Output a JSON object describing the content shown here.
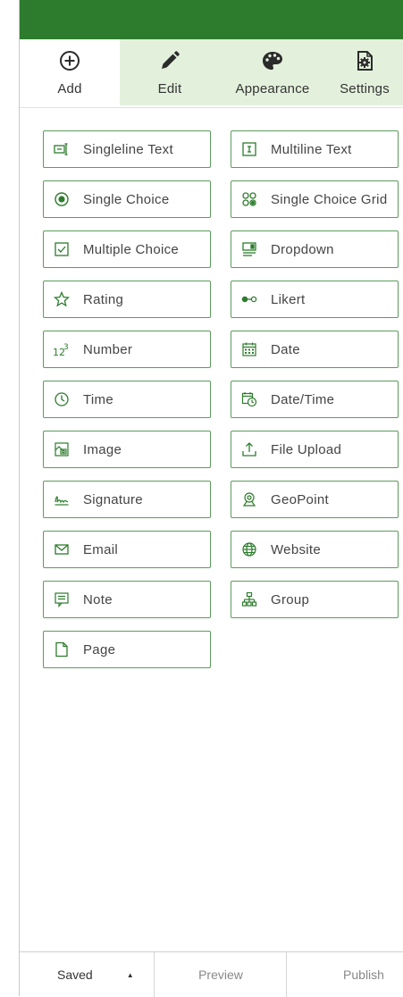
{
  "tabs": [
    {
      "label": "Add",
      "icon": "plus-circle-icon",
      "active": true
    },
    {
      "label": "Edit",
      "icon": "pencil-icon",
      "active": false
    },
    {
      "label": "Appearance",
      "icon": "palette-icon",
      "active": false
    },
    {
      "label": "Settings",
      "icon": "settings-document-icon",
      "active": false
    }
  ],
  "questions": [
    {
      "label": "Singleline Text",
      "icon": "singleline-text-icon"
    },
    {
      "label": "Multiline Text",
      "icon": "multiline-text-icon"
    },
    {
      "label": "Single Choice",
      "icon": "radio-button-icon"
    },
    {
      "label": "Single Choice Grid",
      "icon": "choice-grid-icon"
    },
    {
      "label": "Multiple Choice",
      "icon": "checkbox-icon"
    },
    {
      "label": "Dropdown",
      "icon": "dropdown-icon"
    },
    {
      "label": "Rating",
      "icon": "star-icon"
    },
    {
      "label": "Likert",
      "icon": "likert-icon"
    },
    {
      "label": "Number",
      "icon": "number-icon"
    },
    {
      "label": "Date",
      "icon": "calendar-icon"
    },
    {
      "label": "Time",
      "icon": "clock-icon"
    },
    {
      "label": "Date/Time",
      "icon": "calendar-clock-icon"
    },
    {
      "label": "Image",
      "icon": "image-icon"
    },
    {
      "label": "File Upload",
      "icon": "upload-icon"
    },
    {
      "label": "Signature",
      "icon": "signature-icon"
    },
    {
      "label": "GeoPoint",
      "icon": "map-pin-icon"
    },
    {
      "label": "Email",
      "icon": "envelope-icon"
    },
    {
      "label": "Website",
      "icon": "globe-icon"
    },
    {
      "label": "Note",
      "icon": "note-icon"
    },
    {
      "label": "Group",
      "icon": "group-icon"
    },
    {
      "label": "Page",
      "icon": "page-icon"
    }
  ],
  "footer": {
    "saved_label": "Saved",
    "preview_label": "Preview",
    "publish_label": "Publish"
  },
  "colors": {
    "brand_green": "#2d7c2d",
    "tab_inactive_bg": "#e3f1dc",
    "tile_border": "#5b9c5b"
  }
}
